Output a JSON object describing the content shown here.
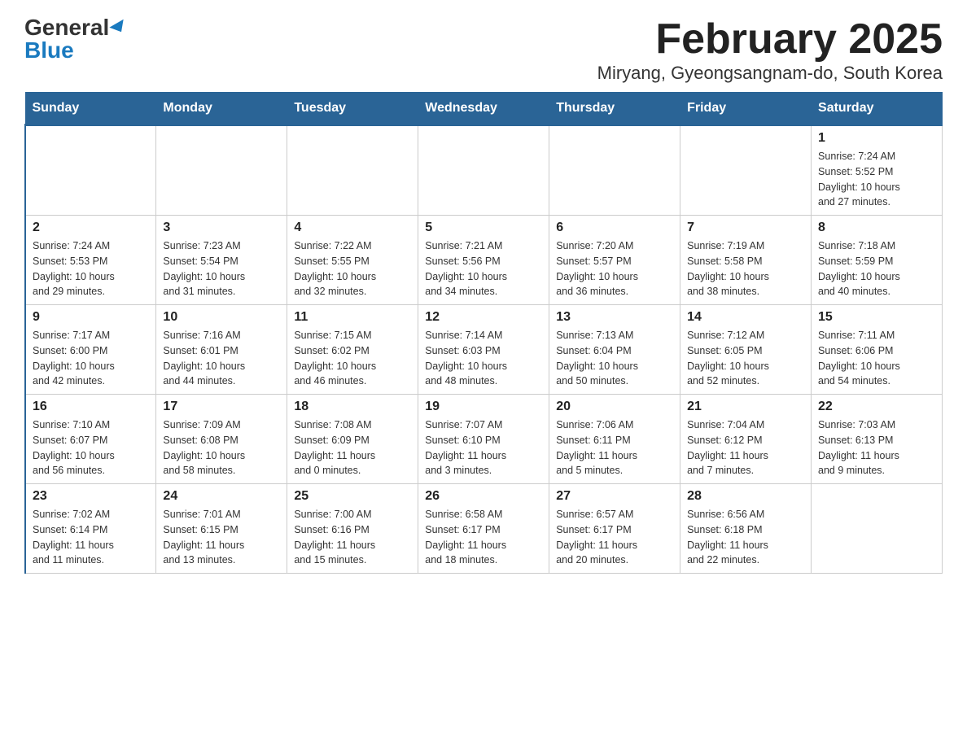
{
  "logo": {
    "general": "General",
    "blue": "Blue"
  },
  "title": "February 2025",
  "subtitle": "Miryang, Gyeongsangnam-do, South Korea",
  "days_of_week": [
    "Sunday",
    "Monday",
    "Tuesday",
    "Wednesday",
    "Thursday",
    "Friday",
    "Saturday"
  ],
  "weeks": [
    [
      {
        "day": "",
        "info": ""
      },
      {
        "day": "",
        "info": ""
      },
      {
        "day": "",
        "info": ""
      },
      {
        "day": "",
        "info": ""
      },
      {
        "day": "",
        "info": ""
      },
      {
        "day": "",
        "info": ""
      },
      {
        "day": "1",
        "info": "Sunrise: 7:24 AM\nSunset: 5:52 PM\nDaylight: 10 hours\nand 27 minutes."
      }
    ],
    [
      {
        "day": "2",
        "info": "Sunrise: 7:24 AM\nSunset: 5:53 PM\nDaylight: 10 hours\nand 29 minutes."
      },
      {
        "day": "3",
        "info": "Sunrise: 7:23 AM\nSunset: 5:54 PM\nDaylight: 10 hours\nand 31 minutes."
      },
      {
        "day": "4",
        "info": "Sunrise: 7:22 AM\nSunset: 5:55 PM\nDaylight: 10 hours\nand 32 minutes."
      },
      {
        "day": "5",
        "info": "Sunrise: 7:21 AM\nSunset: 5:56 PM\nDaylight: 10 hours\nand 34 minutes."
      },
      {
        "day": "6",
        "info": "Sunrise: 7:20 AM\nSunset: 5:57 PM\nDaylight: 10 hours\nand 36 minutes."
      },
      {
        "day": "7",
        "info": "Sunrise: 7:19 AM\nSunset: 5:58 PM\nDaylight: 10 hours\nand 38 minutes."
      },
      {
        "day": "8",
        "info": "Sunrise: 7:18 AM\nSunset: 5:59 PM\nDaylight: 10 hours\nand 40 minutes."
      }
    ],
    [
      {
        "day": "9",
        "info": "Sunrise: 7:17 AM\nSunset: 6:00 PM\nDaylight: 10 hours\nand 42 minutes."
      },
      {
        "day": "10",
        "info": "Sunrise: 7:16 AM\nSunset: 6:01 PM\nDaylight: 10 hours\nand 44 minutes."
      },
      {
        "day": "11",
        "info": "Sunrise: 7:15 AM\nSunset: 6:02 PM\nDaylight: 10 hours\nand 46 minutes."
      },
      {
        "day": "12",
        "info": "Sunrise: 7:14 AM\nSunset: 6:03 PM\nDaylight: 10 hours\nand 48 minutes."
      },
      {
        "day": "13",
        "info": "Sunrise: 7:13 AM\nSunset: 6:04 PM\nDaylight: 10 hours\nand 50 minutes."
      },
      {
        "day": "14",
        "info": "Sunrise: 7:12 AM\nSunset: 6:05 PM\nDaylight: 10 hours\nand 52 minutes."
      },
      {
        "day": "15",
        "info": "Sunrise: 7:11 AM\nSunset: 6:06 PM\nDaylight: 10 hours\nand 54 minutes."
      }
    ],
    [
      {
        "day": "16",
        "info": "Sunrise: 7:10 AM\nSunset: 6:07 PM\nDaylight: 10 hours\nand 56 minutes."
      },
      {
        "day": "17",
        "info": "Sunrise: 7:09 AM\nSunset: 6:08 PM\nDaylight: 10 hours\nand 58 minutes."
      },
      {
        "day": "18",
        "info": "Sunrise: 7:08 AM\nSunset: 6:09 PM\nDaylight: 11 hours\nand 0 minutes."
      },
      {
        "day": "19",
        "info": "Sunrise: 7:07 AM\nSunset: 6:10 PM\nDaylight: 11 hours\nand 3 minutes."
      },
      {
        "day": "20",
        "info": "Sunrise: 7:06 AM\nSunset: 6:11 PM\nDaylight: 11 hours\nand 5 minutes."
      },
      {
        "day": "21",
        "info": "Sunrise: 7:04 AM\nSunset: 6:12 PM\nDaylight: 11 hours\nand 7 minutes."
      },
      {
        "day": "22",
        "info": "Sunrise: 7:03 AM\nSunset: 6:13 PM\nDaylight: 11 hours\nand 9 minutes."
      }
    ],
    [
      {
        "day": "23",
        "info": "Sunrise: 7:02 AM\nSunset: 6:14 PM\nDaylight: 11 hours\nand 11 minutes."
      },
      {
        "day": "24",
        "info": "Sunrise: 7:01 AM\nSunset: 6:15 PM\nDaylight: 11 hours\nand 13 minutes."
      },
      {
        "day": "25",
        "info": "Sunrise: 7:00 AM\nSunset: 6:16 PM\nDaylight: 11 hours\nand 15 minutes."
      },
      {
        "day": "26",
        "info": "Sunrise: 6:58 AM\nSunset: 6:17 PM\nDaylight: 11 hours\nand 18 minutes."
      },
      {
        "day": "27",
        "info": "Sunrise: 6:57 AM\nSunset: 6:17 PM\nDaylight: 11 hours\nand 20 minutes."
      },
      {
        "day": "28",
        "info": "Sunrise: 6:56 AM\nSunset: 6:18 PM\nDaylight: 11 hours\nand 22 minutes."
      },
      {
        "day": "",
        "info": ""
      }
    ]
  ]
}
